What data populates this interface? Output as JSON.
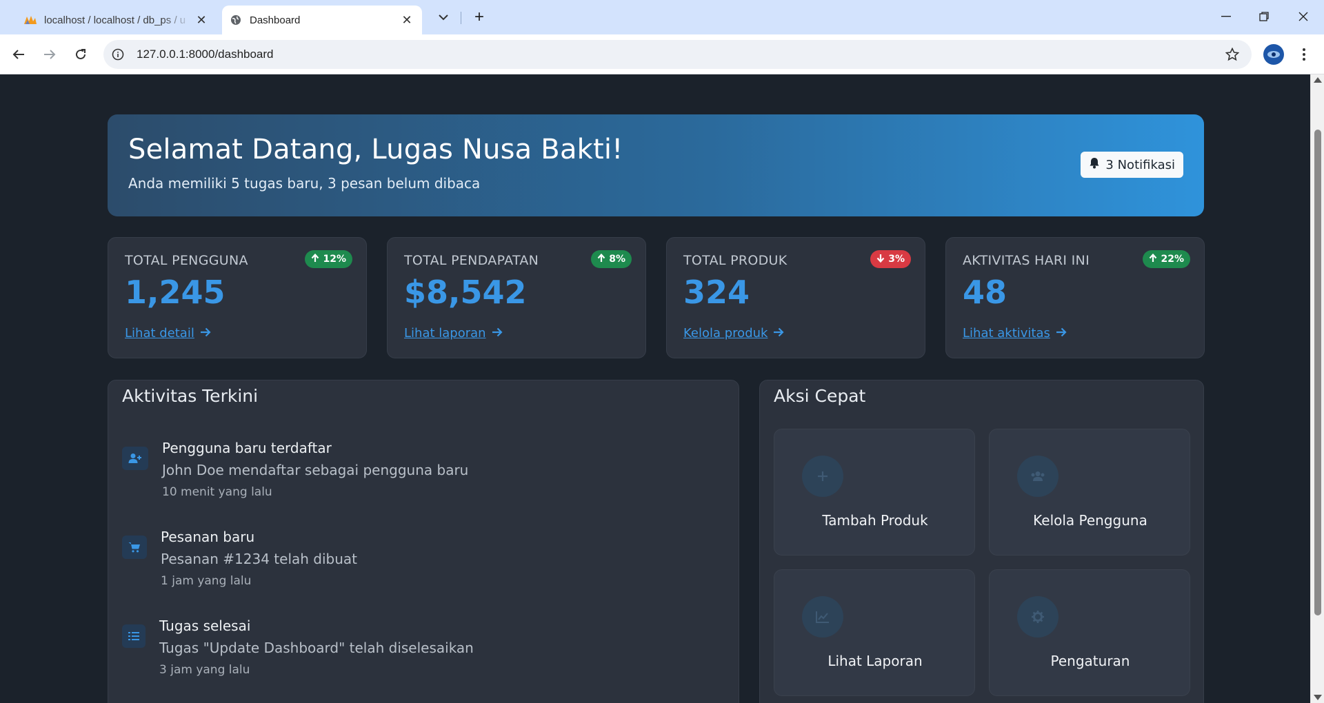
{
  "browser": {
    "tabs": [
      {
        "title": "localhost / localhost / db_ps / u",
        "active": false,
        "favicon": "phpmyadmin-icon"
      },
      {
        "title": "Dashboard",
        "active": true,
        "favicon": "globe-icon"
      }
    ],
    "url": "127.0.0.1:8000/dashboard"
  },
  "hero": {
    "title": "Selamat Datang, Lugas Nusa Bakti!",
    "subtitle": "Anda memiliki 5 tugas baru, 3 pesan belum dibaca",
    "notif_label": "3 Notifikasi"
  },
  "stats": [
    {
      "label": "TOTAL PENGGUNA",
      "badge": "12%",
      "trend": "up",
      "value": "1,245",
      "link": "Lihat detail"
    },
    {
      "label": "TOTAL PENDAPATAN",
      "badge": "8%",
      "trend": "up",
      "value": "$8,542",
      "link": "Lihat laporan"
    },
    {
      "label": "TOTAL PRODUK",
      "badge": "3%",
      "trend": "down",
      "value": "324",
      "link": "Kelola produk"
    },
    {
      "label": "AKTIVITAS HARI INI",
      "badge": "22%",
      "trend": "up",
      "value": "48",
      "link": "Lihat aktivitas"
    }
  ],
  "activity": {
    "title": "Aktivitas Terkini",
    "items": [
      {
        "icon": "user-plus-icon",
        "title": "Pengguna baru terdaftar",
        "desc": "John Doe mendaftar sebagai pengguna baru",
        "time": "10 menit yang lalu"
      },
      {
        "icon": "cart-icon",
        "title": "Pesanan baru",
        "desc": "Pesanan #1234 telah dibuat",
        "time": "1 jam yang lalu"
      },
      {
        "icon": "task-list-icon",
        "title": "Tugas selesai",
        "desc": "Tugas \"Update Dashboard\" telah diselesaikan",
        "time": "3 jam yang lalu"
      }
    ]
  },
  "quick": {
    "title": "Aksi Cepat",
    "items": [
      {
        "icon": "plus-icon",
        "label": "Tambah Produk"
      },
      {
        "icon": "users-icon",
        "label": "Kelola Pengguna"
      },
      {
        "icon": "chart-icon",
        "label": "Lihat Laporan"
      },
      {
        "icon": "gear-icon",
        "label": "Pengaturan"
      }
    ]
  },
  "colors": {
    "accent": "#3a97e6",
    "badge_up": "#1e8a4e",
    "badge_down": "#d83a43",
    "page_bg": "#1b222b",
    "card_bg": "#2c323d"
  }
}
